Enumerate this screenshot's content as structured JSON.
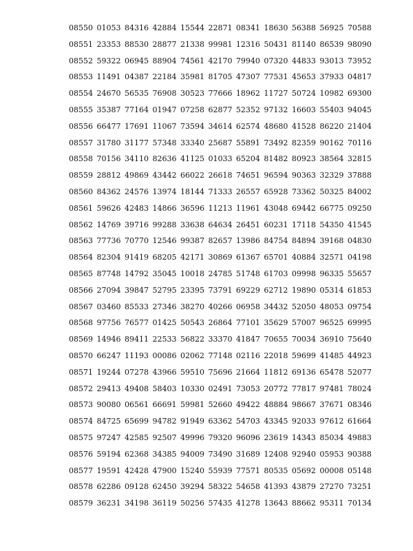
{
  "rows": [
    "08550   01053 84316  42884 15544  22871 08341  18630 56388  56925 70588",
    "08551   23353 88530  28877 21338  99981 12316  50431 81140  86539 98090",
    "08552   59322 06945  88904 74561  42170 79940  07320 44833  93013 73952",
    "08553   11491 04387  22184 35981  81705 47307  77531 45653  37933 04817",
    "08554   24670 56535  76908 30523  77666 18962  11727 50724  10982 69300",
    "08555   35387 77164  01947 07258  62877 52352  97132 16603  55403 94045",
    "08556   66477 17691  11067 73594  34614 62574  48680 41528  86220 21404",
    "08557   31780 31177  57348 33340  25687 55891  73492 82359  90162 70116",
    "08558   70156 34110  82636 41125  01033 65204  81482 80923  38564 32815",
    "08559   28812 49869  43442 66022  26618 74651  96594 90363  32329 37888",
    "08560   84362 24576  13974 18144  71333 26557  65928 73362  50325 84002",
    "08561   59626 42483  14866 36596  11213 11961  43048 69442  66775 09250",
    "08562   14769 39716  99288 33638  64634 26451  60231 17118  54350 41545",
    "08563   77736 70770  12546 99387  82657 13986  84754 84894  39168 04830",
    "08564   82304 91419  68205 42171  30869 61367  65701 40884  32571 04198",
    "08565   87748 14792  35045 10018  24785 51748  61703 09998  96335 55657",
    "08566   27094 39847  52795 23395  73791 69229  62712 19890  05314 61853",
    "08567   03460 85533  27346 38270  40266 06958  34432 52050  48053 09754",
    "08568   97756 76577  01425 50543  26864 77101  35629 57007  96525 69995",
    "08569   14946 89411  22533 56822  33370 41847  70655 70034  36910 75640",
    "08570   66247 11193  00086 02062  77148 02116  22018 59699  41485 44923",
    "08571   19244 07278  43966 59510  75696 21664  11812 69136  65478 52077",
    "08572   29413 49408  58403 10330  02491 73053  20772 77817  97481 78024",
    "08573   90080 06561  66691 59981  52660 49422  48884 98667  37671 08346",
    "08574   84725 65699  94782 91949  63362 54703  43345 92033  97612 61664",
    "08575   97247 42585  92507 49996  79320 96096  23619 14343  85034 49883",
    "08576   59194 62368  34385 94009  73490 31689  12408 92940  05953 90388",
    "08577   19591 42428  47900 15240  55939 77571  80535 05692  00008 05148",
    "08578   62286 09128  62450 39294  58322 54658  41393 43879  27270 73251",
    "08579   36231 34198  36119 50256  57435 41278  13643 88662  95311 70134"
  ]
}
